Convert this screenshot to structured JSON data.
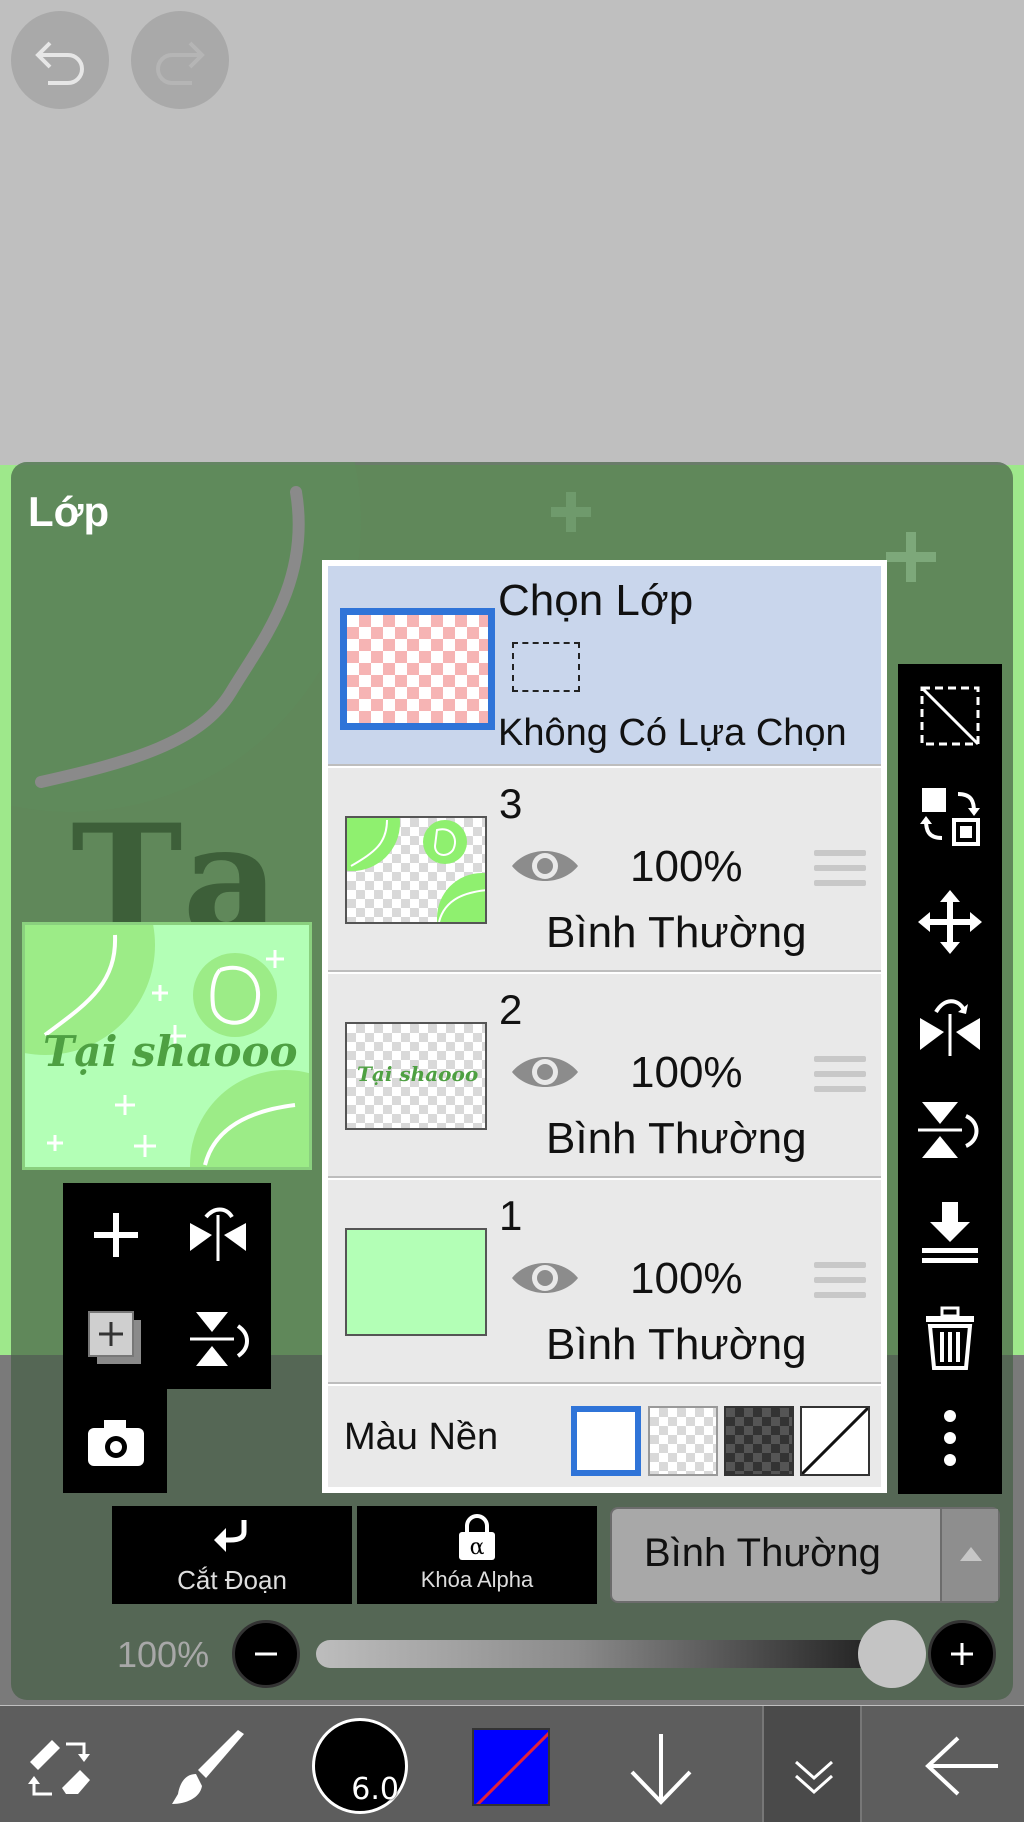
{
  "header": {
    "undo_icon": "undo-icon",
    "redo_icon": "redo-icon"
  },
  "panel": {
    "title": "Lớp",
    "preview": {
      "text": "Tại shaooo"
    }
  },
  "selection_layer": {
    "title": "Chọn Lớp",
    "status": "Không Có Lựa Chọn"
  },
  "layers": [
    {
      "number": "3",
      "opacity": "100%",
      "blend": "Bình Thường",
      "visible": true
    },
    {
      "number": "2",
      "opacity": "100%",
      "blend": "Bình Thường",
      "visible": true,
      "thumb_text": "Tại shaooo"
    },
    {
      "number": "1",
      "opacity": "100%",
      "blend": "Bình Thường",
      "visible": true
    }
  ],
  "background_color": {
    "label": "Màu Nền",
    "options": [
      "white",
      "transparent",
      "dark-checker",
      "none"
    ],
    "selected": "white"
  },
  "controls": {
    "clipping_label": "Cắt Đoạn",
    "alpha_lock_label": "Khóa Alpha",
    "blend_mode": "Bình Thường",
    "opacity": "100%"
  },
  "bottom_bar": {
    "brush_size": "6.0",
    "primary_color": "#0000ff"
  },
  "colors": {
    "accent_blue": "#2f74d8",
    "selection_row": "#c9d6ec",
    "stage_green": "#9ee88b"
  }
}
